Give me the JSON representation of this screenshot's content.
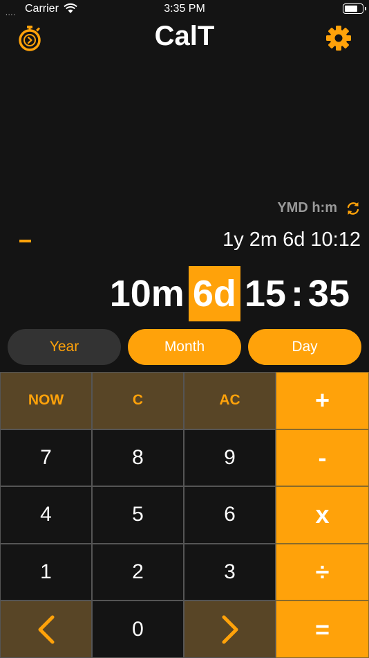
{
  "status_bar": {
    "signal": "....",
    "carrier": "Carrier",
    "time": "3:35 PM"
  },
  "header": {
    "title": "CalT"
  },
  "display": {
    "format_label": "YMD h:m",
    "sign": "-",
    "result": "1y 2m 6d 10:12",
    "main": {
      "month": "10m",
      "day": "6d",
      "hour": "15",
      "sep": ":",
      "minute": "35"
    }
  },
  "unit_buttons": {
    "year": "Year",
    "month": "Month",
    "day": "Day"
  },
  "keypad": {
    "now": "NOW",
    "clear": "C",
    "all_clear": "AC",
    "plus": "+",
    "minus": "-",
    "multiply": "x",
    "divide": "÷",
    "equals": "=",
    "k7": "7",
    "k8": "8",
    "k9": "9",
    "k4": "4",
    "k5": "5",
    "k6": "6",
    "k1": "1",
    "k2": "2",
    "k3": "3",
    "k0": "0"
  },
  "colors": {
    "accent": "#ffa20a",
    "background": "#141414",
    "function_key": "#584526"
  },
  "icons": {
    "stopwatch": "stopwatch-icon",
    "settings": "gear-icon",
    "refresh": "refresh-icon",
    "left": "chevron-left-icon",
    "right": "chevron-right-icon"
  }
}
